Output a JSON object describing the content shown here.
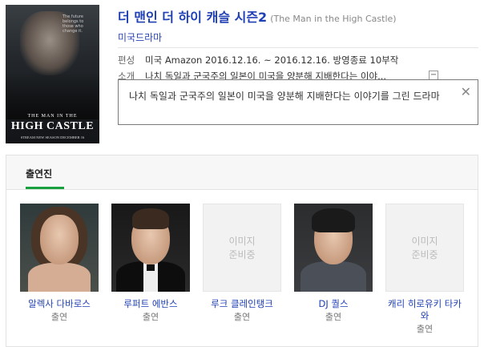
{
  "show": {
    "title": "더 맨인 더 하이 캐슬 시즌2",
    "original_title": "(The Man in the High Castle)",
    "genre": "미국드라마",
    "info_label": "편성",
    "info_value": "미국 Amazon 2016.12.16. ~ 2016.12.16. 방영종료 10부작",
    "summary_label": "소개",
    "summary_short": "나치 독일과 군국주의 일본이 미국을 양분해 지배한다는 이야...",
    "summary_full": "나치 독일과 군국주의 일본이 미국을 양분해 지배한다는 이야기를 그린 드라마",
    "toggle_symbol": "−",
    "close_symbol": "✕"
  },
  "poster": {
    "tagline": "The future belongs to those who change it.",
    "small_title": "THE MAN IN THE",
    "big_title": "HIGH CASTLE",
    "footer": "STREAM NEW SEASON DECEMBER 16"
  },
  "cast_section": {
    "tab_label": "출연진",
    "no_image_text_line1": "이미지",
    "no_image_text_line2": "준비중",
    "people": [
      {
        "name": "알렉사 다바로스",
        "role": "출연",
        "has_photo": true
      },
      {
        "name": "루퍼트 에반스",
        "role": "출연",
        "has_photo": true
      },
      {
        "name": "루크 클레인탱크",
        "role": "출연",
        "has_photo": false
      },
      {
        "name": "DJ 퀄스",
        "role": "출연",
        "has_photo": true
      },
      {
        "name": "캐리 히로유키 타카와",
        "role": "출연",
        "has_photo": false
      }
    ]
  },
  "colors": {
    "title_blue": "#1f3fb4",
    "tab_green": "#18a03e",
    "border": "#e3e3e3"
  }
}
